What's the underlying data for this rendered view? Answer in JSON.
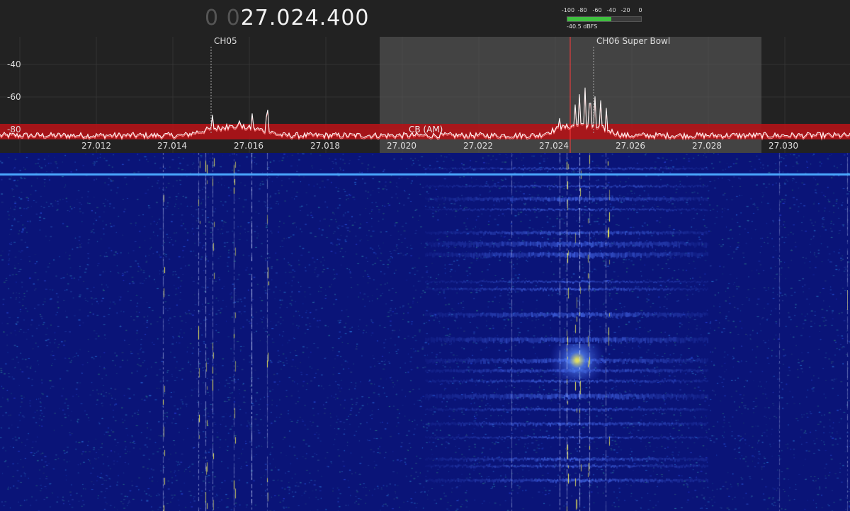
{
  "frequency": {
    "dim_prefix": "0 0",
    "value": "27.024.400"
  },
  "smeter": {
    "scale": [
      "-100",
      "-80",
      "-60",
      "-40",
      "-20",
      "0"
    ],
    "reading": "-40.5 dBFS",
    "level_fraction": 0.6
  },
  "spectrum": {
    "y_ticks": [
      "-40",
      "-60",
      "-80"
    ],
    "x_ticks": [
      "27.012",
      "27.014",
      "27.016",
      "27.018",
      "27.020",
      "27.022",
      "27.024",
      "27.026",
      "27.028",
      "27.030"
    ],
    "channel_markers": [
      {
        "label": "CH05"
      },
      {
        "label": "CH06 Super Bowl"
      }
    ],
    "band_label": "CB (AM)",
    "colors": {
      "background": "#222222",
      "trace": "#ffffff",
      "band_highlight": "#b01418",
      "selection": "#5a5a5a",
      "tuning_line": "#ff3b3b"
    }
  },
  "waterfall": {
    "colors": {
      "background": "#0a1478",
      "signal": "#4f7cff",
      "peak": "#f4f058",
      "marker_line": "#4aa8ff"
    }
  }
}
